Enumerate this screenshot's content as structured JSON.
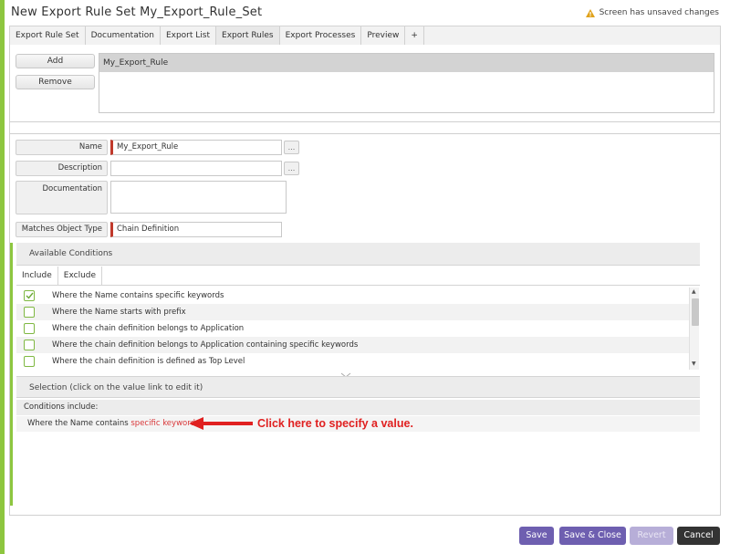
{
  "window": {
    "title": "New Export Rule Set My_Export_Rule_Set",
    "unsaved_text": "Screen has unsaved changes"
  },
  "tabs": [
    {
      "label": "Export Rule Set"
    },
    {
      "label": "Documentation"
    },
    {
      "label": "Export List"
    },
    {
      "label": "Export Rules",
      "active": true
    },
    {
      "label": "Export Processes"
    },
    {
      "label": "Preview"
    },
    {
      "label": "+"
    }
  ],
  "rules": {
    "add_label": "Add",
    "remove_label": "Remove",
    "items": [
      "My_Export_Rule"
    ]
  },
  "form": {
    "name_label": "Name",
    "name_value": "My_Export_Rule",
    "description_label": "Description",
    "description_value": "",
    "documentation_label": "Documentation",
    "documentation_value": "",
    "matches_label": "Matches Object Type",
    "matches_value": "Chain Definition",
    "ellipsis": "..."
  },
  "conditions": {
    "header": "Available Conditions",
    "include_tab": "Include",
    "exclude_tab": "Exclude",
    "items": [
      {
        "label": "Where the Name contains specific keywords",
        "checked": true
      },
      {
        "label": "Where the Name starts with prefix",
        "checked": false
      },
      {
        "label": "Where the chain definition belongs to Application",
        "checked": false
      },
      {
        "label": "Where the chain definition belongs to Application containing specific keywords",
        "checked": false
      },
      {
        "label": "Where the chain definition is defined as Top Level",
        "checked": false
      }
    ]
  },
  "selection": {
    "header": "Selection (click on the value link to edit it)",
    "conditions_include": "Conditions include:",
    "row_prefix": "Where the Name contains",
    "row_link": "specific keywords"
  },
  "annotation": {
    "text": "Click here to specify a value.",
    "color": "#e02020"
  },
  "footer": {
    "save_label": "Save",
    "save_close_label": "Save & Close",
    "revert_label": "Revert",
    "cancel_label": "Cancel"
  },
  "colors": {
    "accent_green": "#8dc63f",
    "button_purple": "#6e5fb0",
    "required_red": "#c0392b",
    "link_red": "#d9383a"
  }
}
